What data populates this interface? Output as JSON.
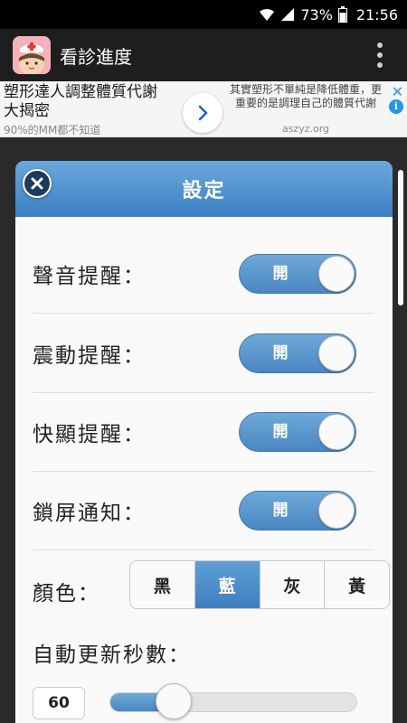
{
  "status_bar": {
    "battery": "73%",
    "time": "21:56",
    "icons": [
      "wifi-icon",
      "signal-icon",
      "battery-icon"
    ]
  },
  "app_bar": {
    "title": "看診進度",
    "logo_icon": "nurse-avatar-icon",
    "menu_icon": "overflow-menu-icon"
  },
  "ad": {
    "headline": "塑形達人調整體質代謝 大揭密",
    "subline": "90%的MM都不知道",
    "body": "其實塑形不單純是降低體重，更重要的是調理自己的體質代謝",
    "domain": "aszyz.org",
    "close_glyph": "✕",
    "info_glyph": "i"
  },
  "dialog": {
    "title": "設定",
    "close_icon": "close-icon",
    "accent": "#4a86c2",
    "toggles": [
      {
        "label": "聲音提醒：",
        "state": "開"
      },
      {
        "label": "震動提醒：",
        "state": "開"
      },
      {
        "label": "快顯提醒：",
        "state": "開"
      },
      {
        "label": "鎖屏通知：",
        "state": "開"
      }
    ],
    "color": {
      "label": "顏色：",
      "options": [
        "黑",
        "藍",
        "灰",
        "黃"
      ],
      "selected": "藍"
    },
    "refresh": {
      "label": "自動更新秒數：",
      "value": "60",
      "slider_fraction": 0.2
    }
  }
}
